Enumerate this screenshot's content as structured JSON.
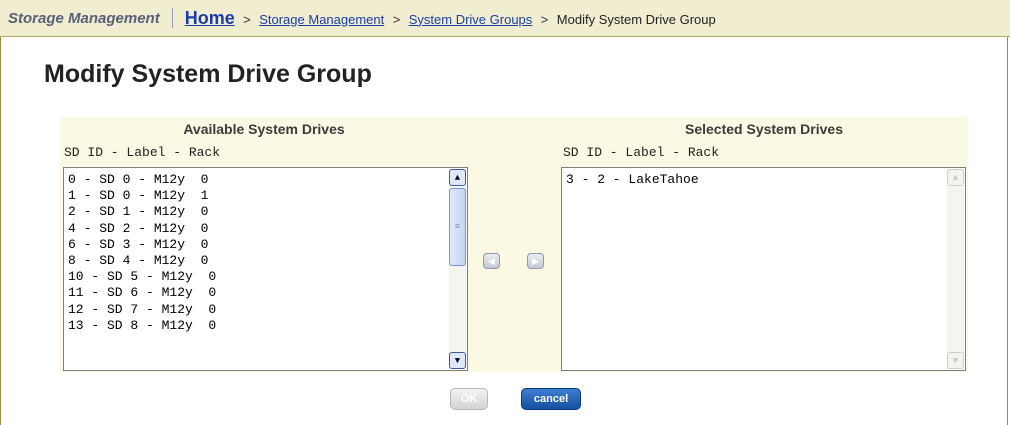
{
  "header": {
    "app_title": "Storage Management",
    "breadcrumb": {
      "home": "Home",
      "separator": ">",
      "links": [
        "Storage Management",
        "System Drive Groups"
      ],
      "current": "Modify System Drive Group"
    }
  },
  "page": {
    "title": "Modify System Drive Group"
  },
  "available": {
    "heading": "Available System Drives",
    "columns_label": "SD ID - Label - Rack",
    "items": [
      "0 - SD 0 - M12y  0",
      "1 - SD 0 - M12y  1",
      "2 - SD 1 - M12y  0",
      "4 - SD 2 - M12y  0",
      "6 - SD 3 - M12y  0",
      "8 - SD 4 - M12y  0",
      "10 - SD 5 - M12y  0",
      "11 - SD 6 - M12y  0",
      "12 - SD 7 - M12y  0",
      "13 - SD 8 - M12y  0"
    ],
    "scrollbar": {
      "up_icon": "▲",
      "down_icon": "▼",
      "grip_icon": "≡"
    }
  },
  "selected": {
    "heading": "Selected System Drives",
    "columns_label": "SD ID - Label - Rack",
    "items": [
      "3 - 2 - LakeTahoe"
    ],
    "scrollbar": {
      "up_icon": "▲",
      "down_icon": "▼"
    }
  },
  "transfer": {
    "left_icon": "◀",
    "right_icon": "▶"
  },
  "actions": {
    "ok_label": "OK",
    "cancel_label": "cancel"
  },
  "colors": {
    "header_bg": "#f1edd0",
    "link": "#1a3ea8",
    "panel_bg": "#fbf9e4",
    "cancel_button": "#1f5bb0"
  }
}
